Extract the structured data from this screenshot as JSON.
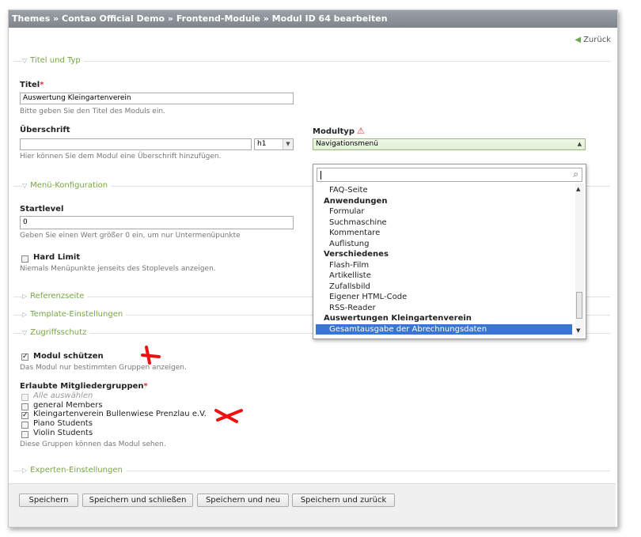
{
  "breadcrumb": "Themes » Contao Official Demo » Frontend-Module » Modul ID 64 bearbeiten",
  "back_label": "Zurück",
  "sections": {
    "titel_typ": "Titel und Typ",
    "menu": "Menü-Konfiguration",
    "referenz": "Referenzseite",
    "template": "Template-Einstellungen",
    "zugriff": "Zugriffsschutz",
    "experten": "Experten-Einstellungen"
  },
  "titel": {
    "label": "Titel",
    "required": "*",
    "value": "Auswertung Kleingartenverein",
    "help": "Bitte geben Sie den Titel des Moduls ein."
  },
  "ueberschrift": {
    "label": "Überschrift",
    "value": "",
    "level": "h1",
    "help": "Hier können Sie dem Modul eine Überschrift hinzufügen."
  },
  "modultyp": {
    "label": "Modultyp",
    "value": "Navigationsmenü",
    "search_value": "",
    "options": [
      {
        "type": "item",
        "label": "FAQ-Seite"
      },
      {
        "type": "group",
        "label": "Anwendungen"
      },
      {
        "type": "item",
        "label": "Formular"
      },
      {
        "type": "item",
        "label": "Suchmaschine"
      },
      {
        "type": "item",
        "label": "Kommentare"
      },
      {
        "type": "item",
        "label": "Auflistung"
      },
      {
        "type": "group",
        "label": "Verschiedenes"
      },
      {
        "type": "item",
        "label": "Flash-Film"
      },
      {
        "type": "item",
        "label": "Artikelliste"
      },
      {
        "type": "item",
        "label": "Zufallsbild"
      },
      {
        "type": "item",
        "label": "Eigener HTML-Code"
      },
      {
        "type": "item",
        "label": "RSS-Reader"
      },
      {
        "type": "group",
        "label": "Auswertungen Kleingartenverein"
      },
      {
        "type": "item",
        "label": "Gesamtausgabe der Abrechnungsdaten",
        "selected": true
      }
    ]
  },
  "startlevel": {
    "label": "Startlevel",
    "value": "0",
    "help": "Geben Sie einen Wert größer 0 ein, um nur Untermenüpunkte"
  },
  "hard_limit": {
    "label": "Hard Limit",
    "checked": false,
    "help": "Niemals Menüpunkte jenseits des Stoplevels anzeigen."
  },
  "protect": {
    "label": "Modul schützen",
    "checked": true,
    "help": "Das Modul nur bestimmten Gruppen anzeigen."
  },
  "groups": {
    "label": "Erlaubte Mitgliedergruppen",
    "required": "*",
    "select_all": "Alle auswählen",
    "items": [
      {
        "label": "general Members",
        "checked": false
      },
      {
        "label": "Kleingartenverein Bullenwiese Prenzlau e.V.",
        "checked": true
      },
      {
        "label": "Piano Students",
        "checked": false
      },
      {
        "label": "Violin Students",
        "checked": false
      }
    ],
    "help": "Diese Gruppen können das Modul sehen."
  },
  "buttons": {
    "save": "Speichern",
    "save_close": "Speichern und schließen",
    "save_new": "Speichern und neu",
    "save_back": "Speichern und zurück"
  },
  "colors": {
    "accent_green": "#77a544",
    "selected_blue": "#3875d7",
    "annotation_red": "#ee1111"
  }
}
